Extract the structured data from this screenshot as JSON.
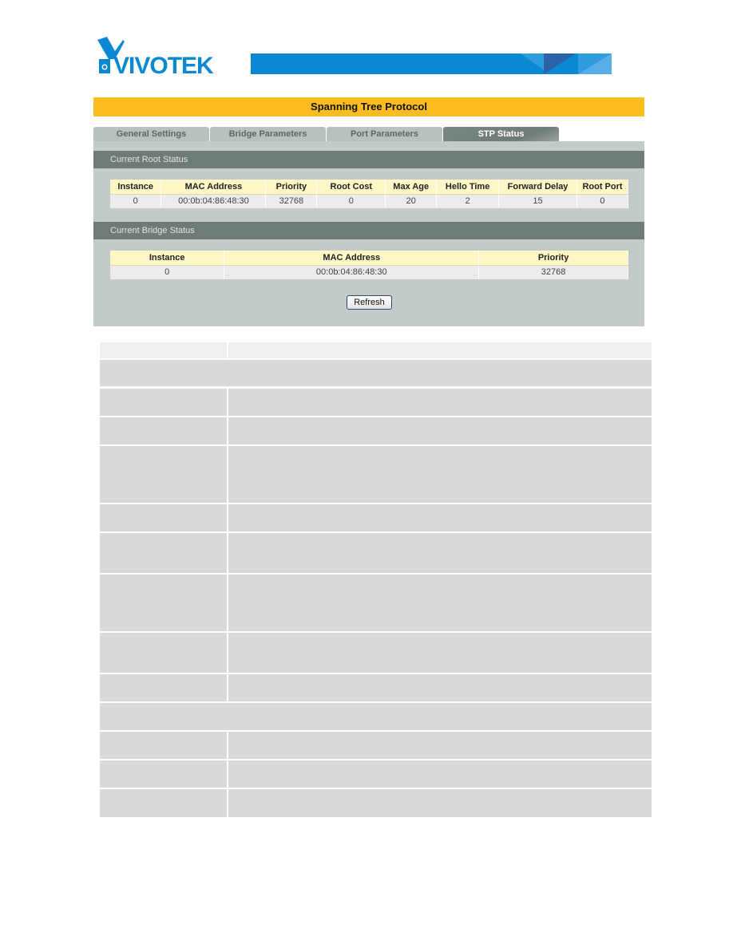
{
  "brand": {
    "name": "VIVOTEK",
    "logo_icon": "vivotek-camera-logo-icon",
    "colors": {
      "primary": "#0a88d2",
      "dark": "#2b62a8",
      "light": "#58aee6"
    }
  },
  "page": {
    "title": "Spanning Tree Protocol",
    "title_bar_color": "#fbbd1f"
  },
  "tabs": [
    {
      "label": "General Settings",
      "active": false
    },
    {
      "label": "Bridge Parameters",
      "active": false
    },
    {
      "label": "Port Parameters",
      "active": false
    },
    {
      "label": "STP Status",
      "active": true
    }
  ],
  "root_status": {
    "heading": "Current Root Status",
    "columns": [
      "Instance",
      "MAC Address",
      "Priority",
      "Root Cost",
      "Max Age",
      "Hello Time",
      "Forward Delay",
      "Root Port"
    ],
    "rows": [
      [
        "0",
        "00:0b:04:86:48:30",
        "32768",
        "0",
        "20",
        "2",
        "15",
        "0"
      ]
    ]
  },
  "bridge_status": {
    "heading": "Current Bridge Status",
    "columns": [
      "Instance",
      "MAC Address",
      "Priority"
    ],
    "rows": [
      [
        "0",
        "00:0b:04:86:48:30",
        "32768"
      ]
    ]
  },
  "actions": {
    "refresh_label": "Refresh"
  },
  "description_table": {
    "rows": [
      {
        "type": "header",
        "left": "",
        "right": ""
      },
      {
        "type": "full",
        "text": ""
      },
      {
        "type": "split",
        "left": "",
        "right": ""
      },
      {
        "type": "split",
        "left": "",
        "right": ""
      },
      {
        "type": "split",
        "left": "",
        "right": ""
      },
      {
        "type": "split",
        "left": "",
        "right": ""
      },
      {
        "type": "split",
        "left": "",
        "right": ""
      },
      {
        "type": "split",
        "left": "",
        "right": ""
      },
      {
        "type": "split",
        "left": "",
        "right": ""
      },
      {
        "type": "split",
        "left": "",
        "right": ""
      },
      {
        "type": "full",
        "text": ""
      },
      {
        "type": "split",
        "left": "",
        "right": ""
      },
      {
        "type": "split",
        "left": "",
        "right": ""
      },
      {
        "type": "split",
        "left": "",
        "right": ""
      }
    ]
  }
}
